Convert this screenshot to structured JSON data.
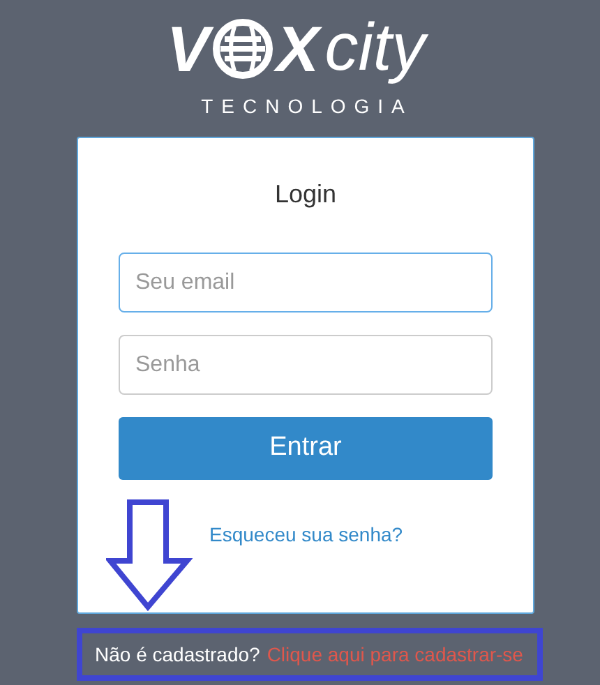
{
  "logo": {
    "lead": "V",
    "mid": "X",
    "tail": "city",
    "tagline": "TECNOLOGIA"
  },
  "login": {
    "title": "Login",
    "fields": [
      {
        "placeholder": "Seu email",
        "focused": true
      },
      {
        "placeholder": "Senha",
        "focused": false
      }
    ],
    "submit": "Entrar",
    "forgot_link": "Esqueceu sua senha?"
  },
  "signup": {
    "question": "Não é cadastrado?",
    "link": "Clique aqui para cadastrar-se",
    "highlighted": true
  },
  "annotation_arrow": {
    "shown": true
  }
}
